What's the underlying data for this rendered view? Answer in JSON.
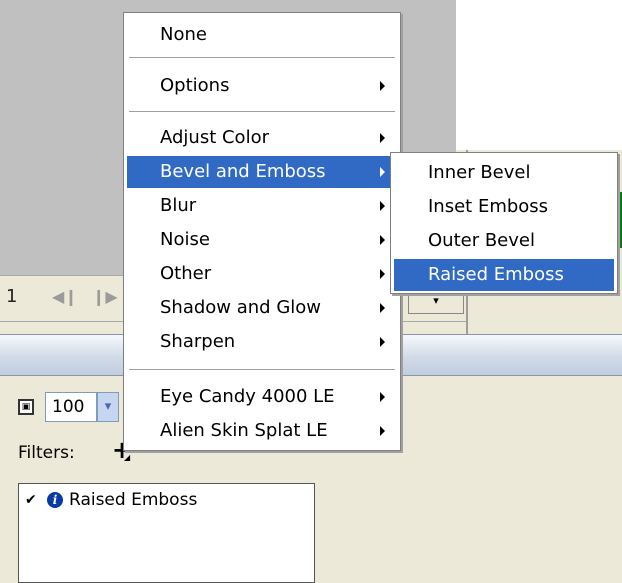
{
  "timeline": {
    "frame_number": "1",
    "dropdown": "▾"
  },
  "panel": {
    "zoom_value": "100",
    "zoom_stepper": "▾",
    "filters_label": "Filters:",
    "add_filter": "+",
    "add_filter_arrow": "◢",
    "filter_item": {
      "checked": "✔",
      "info": "i",
      "label": "Raised Emboss"
    }
  },
  "main_menu": {
    "none": "None",
    "options": "Options",
    "adjust_color": "Adjust Color",
    "bevel_and_emboss": "Bevel and Emboss",
    "blur": "Blur",
    "noise": "Noise",
    "other": "Other",
    "shadow_and_glow": "Shadow and Glow",
    "sharpen": "Sharpen",
    "eye_candy": "Eye Candy 4000 LE",
    "alien_skin": "Alien Skin Splat LE"
  },
  "sub_menu": {
    "inner_bevel": "Inner Bevel",
    "inset_emboss": "Inset Emboss",
    "outer_bevel": "Outer Bevel",
    "raised_emboss": "Raised Emboss"
  },
  "colors": {
    "highlight": "#316ac5",
    "menu_bg": "#ffffff",
    "chrome": "#ece9d8"
  }
}
